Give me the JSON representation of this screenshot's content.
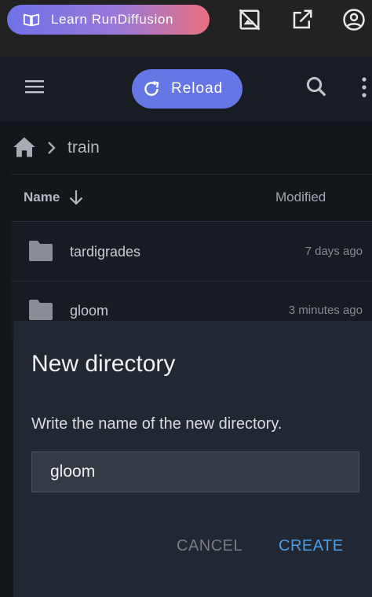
{
  "topbar": {
    "learn_label": "Learn RunDiffusion",
    "icons": [
      "book-icon",
      "hide-image-icon",
      "open-external-icon",
      "account-circle-icon"
    ]
  },
  "appbar": {
    "reload_label": "Reload",
    "icons": [
      "menu-icon",
      "refresh-icon",
      "search-icon",
      "more-vertical-icon"
    ]
  },
  "breadcrumb": {
    "current": "train"
  },
  "table": {
    "columns": {
      "name": "Name",
      "modified": "Modified"
    },
    "sort": "name-descending",
    "rows": [
      {
        "name": "tardigrades",
        "modified": "7 days ago"
      },
      {
        "name": "gloom",
        "modified": "3 minutes ago"
      }
    ]
  },
  "dialog": {
    "title": "New directory",
    "text": "Write the name of the new directory.",
    "input_value": "gloom",
    "cancel_label": "CANCEL",
    "create_label": "CREATE"
  },
  "colors": {
    "accent": "#6576e5",
    "create": "#4a9de6",
    "gradient_start": "#6f71e8",
    "gradient_end": "#e9707f"
  }
}
